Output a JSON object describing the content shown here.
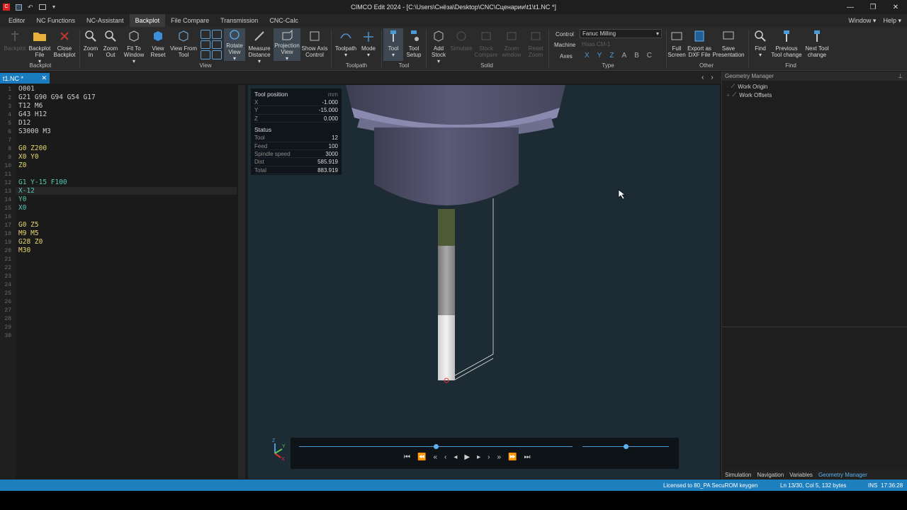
{
  "window": {
    "title": "CIMCO Edit 2024 - [C:\\Users\\Снёза\\Desktop\\CNC\\Сценарии\\t1\\t1.NC *]",
    "controls": [
      "minimize-icon",
      "restore-icon",
      "close-icon"
    ]
  },
  "menu": {
    "tabs": [
      "Editor",
      "NC Functions",
      "NC-Assistant",
      "Backplot",
      "File Compare",
      "Transmission",
      "CNC-Calc"
    ],
    "active": "Backplot",
    "window_label": "Window",
    "help_label": "Help"
  },
  "ribbon": {
    "backplot_group": {
      "label": "Backplot",
      "buttons": [
        "Backplot",
        "Backplot File",
        "Close Backplot"
      ]
    },
    "view_group": {
      "label": "View",
      "buttons": [
        "Zoom In",
        "Zoom Out",
        "Fit To Window",
        "View Reset",
        "View From Tool",
        "Rotate View",
        "Measure Distance",
        "Projection View",
        "Show Axis Control"
      ]
    },
    "toolpath_group": {
      "label": "Toolpath",
      "buttons": [
        "Toolpath",
        "Mode"
      ]
    },
    "tool_group": {
      "label": "Tool",
      "buttons": [
        "Tool",
        "Tool Setup"
      ]
    },
    "solid_group": {
      "label": "Solid",
      "buttons": [
        "Add Stock",
        "Simulate",
        "Stock Compare",
        "Zoom window",
        "Reset Zoom"
      ]
    },
    "type_group": {
      "label": "Type",
      "control_label": "Control",
      "control_value": "Fanuc Milling",
      "machine_label": "Machine",
      "machine_value": "Haas CM-1",
      "axes_label": "Axes",
      "axes": [
        "X",
        "Y",
        "Z",
        "A",
        "B",
        "C"
      ]
    },
    "other_group": {
      "label": "Other",
      "buttons": [
        "Full Screen",
        "Export as DXF File",
        "Save Presentation"
      ]
    },
    "find_group": {
      "label": "Find",
      "buttons": [
        "Find",
        "Previous Tool change",
        "Next Tool change"
      ]
    }
  },
  "document": {
    "tab_label": "t1.NC *"
  },
  "editor": {
    "lines": [
      {
        "n": "1",
        "text": "O001",
        "color": "#cfcfcf"
      },
      {
        "n": "2",
        "text": "G21 G90 G94 G54 G17",
        "color": "#cfcfcf"
      },
      {
        "n": "3",
        "text": "T12 M6",
        "color": "#cfcfcf"
      },
      {
        "n": "4",
        "text": "G43 H12",
        "color": "#cfcfcf"
      },
      {
        "n": "5",
        "text": "D12",
        "color": "#cfcfcf"
      },
      {
        "n": "6",
        "text": "S3000 M3",
        "color": "#cfcfcf"
      },
      {
        "n": "7",
        "text": "",
        "color": "#cfcfcf"
      },
      {
        "n": "8",
        "text": "G0 Z200",
        "color": "#e6d870"
      },
      {
        "n": "9",
        "text": "X0 Y0",
        "color": "#e6d870"
      },
      {
        "n": "10",
        "text": "Z0",
        "color": "#e6d870"
      },
      {
        "n": "11",
        "text": "",
        "color": "#cfcfcf"
      },
      {
        "n": "12",
        "text": "G1 Y-15 F100",
        "color": "#58c7b4"
      },
      {
        "n": "13",
        "text": "X-12",
        "color": "#58c7b4"
      },
      {
        "n": "14",
        "text": "Y0",
        "color": "#58c7b4"
      },
      {
        "n": "15",
        "text": "X0",
        "color": "#58c7b4"
      },
      {
        "n": "16",
        "text": "",
        "color": "#cfcfcf"
      },
      {
        "n": "17",
        "text": "G0 Z5",
        "color": "#e6d870"
      },
      {
        "n": "18",
        "text": "M9 M5",
        "color": "#e6d870"
      },
      {
        "n": "19",
        "text": "G28 Z0",
        "color": "#e6d870"
      },
      {
        "n": "20",
        "text": "M30",
        "color": "#e6d870"
      },
      {
        "n": "21",
        "text": "",
        "color": "#cfcfcf"
      },
      {
        "n": "22",
        "text": "",
        "color": "#cfcfcf"
      },
      {
        "n": "23",
        "text": "",
        "color": "#cfcfcf"
      },
      {
        "n": "24",
        "text": "",
        "color": "#cfcfcf"
      },
      {
        "n": "25",
        "text": "",
        "color": "#cfcfcf"
      },
      {
        "n": "26",
        "text": "",
        "color": "#cfcfcf"
      },
      {
        "n": "27",
        "text": "",
        "color": "#cfcfcf"
      },
      {
        "n": "28",
        "text": "",
        "color": "#cfcfcf"
      },
      {
        "n": "29",
        "text": "",
        "color": "#cfcfcf"
      },
      {
        "n": "30",
        "text": "",
        "color": "#cfcfcf"
      }
    ],
    "current_line": 13
  },
  "tool_info": {
    "position_title": "Tool position",
    "unit": "mm",
    "x_label": "X",
    "x_value": "-1.000",
    "y_label": "Y",
    "y_value": "-15.000",
    "z_label": "Z",
    "z_value": "0.000",
    "status_title": "Status",
    "tool_label": "Tool",
    "tool_value": "12",
    "feed_label": "Feed",
    "feed_value": "100",
    "spindle_label": "Spindle speed",
    "spindle_value": "3000",
    "dist_label": "Dist",
    "dist_value": "585.919",
    "total_label": "Total",
    "total_value": "883.919"
  },
  "playback": {
    "progress": 0.5,
    "speed": 0.5,
    "controls": [
      "first-icon",
      "prev-tool-icon",
      "prev-block-icon",
      "prev-z-icon",
      "step-back-icon",
      "play-icon",
      "step-forward-icon",
      "next-z-icon",
      "next-block-icon",
      "last-icon"
    ]
  },
  "geometry_manager": {
    "title": "Geometry Manager",
    "items": [
      "Work Origin",
      "Work Offsets"
    ]
  },
  "right_tabs": [
    "Simulation",
    "Navigation",
    "Variables",
    "Geometry Manager"
  ],
  "right_active_tab": "Geometry Manager",
  "statusbar": {
    "license": "Licensed to 80_PA SecuROM keygen",
    "position": "Ln 13/30, Col 5, 132 bytes",
    "mode": "INS",
    "time": "17:36:28"
  },
  "colors": {
    "accent": "#1e7fbf",
    "code_yellow": "#e6d870",
    "code_green": "#58c7b4",
    "viewport_bg": "#1d2b34"
  }
}
